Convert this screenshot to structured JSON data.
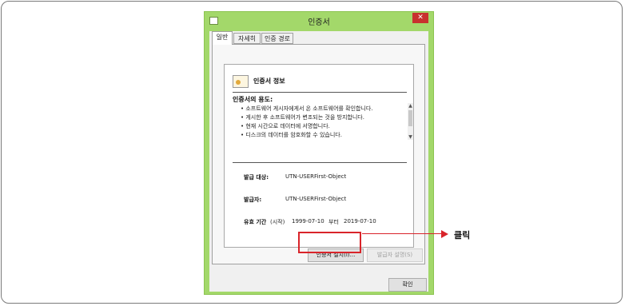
{
  "window": {
    "title": "인증서",
    "close_label": "✕"
  },
  "tabs": [
    {
      "label": "일반"
    },
    {
      "label": "자세히"
    },
    {
      "label": "인증 경로"
    }
  ],
  "cert": {
    "heading": "인증서 정보",
    "purpose_label": "인증서의 용도:",
    "purposes": [
      "• 소프트웨어 게시자에게서 온 소프트웨어를 확인합니다.",
      "• 게시한 후 소프트웨어가 변조되는 것을 방지합니다.",
      "• 현재 시간으로 데이터에 서명합니다.",
      "• 디스크의 데이터를 암호화할 수 있습니다."
    ],
    "issued_to_label": "발급 대상:",
    "issued_to_value": "UTN-USERFirst-Object",
    "issued_by_label": "발급자:",
    "issued_by_value": "UTN-USERFirst-Object",
    "validity_label": "유효 기간",
    "validity_from_label": "(시작)",
    "validity_from": "1999-07-10",
    "validity_to_label": "부터",
    "validity_to": "2019-07-10"
  },
  "buttons": {
    "install": "인증서 설치(I)...",
    "issuer_statement": "발급자 설명(S)",
    "ok": "확인"
  },
  "annotation": {
    "label": "클릭",
    "color": "#d9242a"
  }
}
